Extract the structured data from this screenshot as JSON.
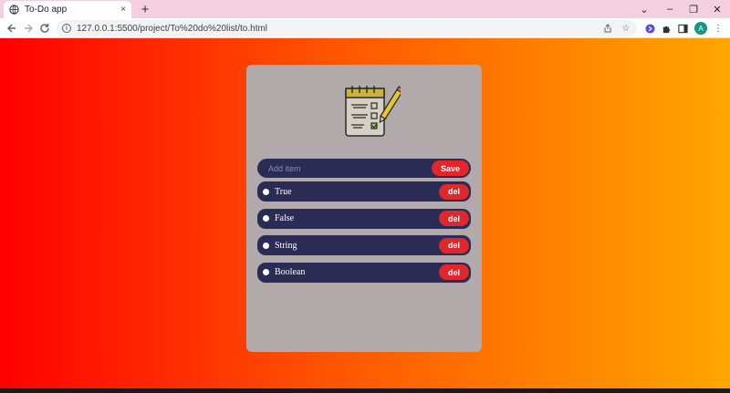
{
  "browser": {
    "tab_title": "To-Do app",
    "tab_close": "×",
    "new_tab": "+",
    "url": "127.0.0.1:5500/project/To%20do%20list/to.html",
    "avatar_initial": "A",
    "window_controls": {
      "minimize": "–",
      "restore": "❐",
      "close": "✕",
      "tabs_menu": "⌄"
    }
  },
  "app": {
    "input_placeholder": "Add item",
    "input_value": "",
    "save_label": "Save",
    "delete_label": "del",
    "items": [
      {
        "label": "True"
      },
      {
        "label": "False"
      },
      {
        "label": "String"
      },
      {
        "label": "Boolean"
      }
    ]
  },
  "colors": {
    "gradient_start": "#ff0000",
    "gradient_end": "#ffa600",
    "card": "#b2aaaa",
    "row": "#2b2c55",
    "button": "#e0272b"
  }
}
